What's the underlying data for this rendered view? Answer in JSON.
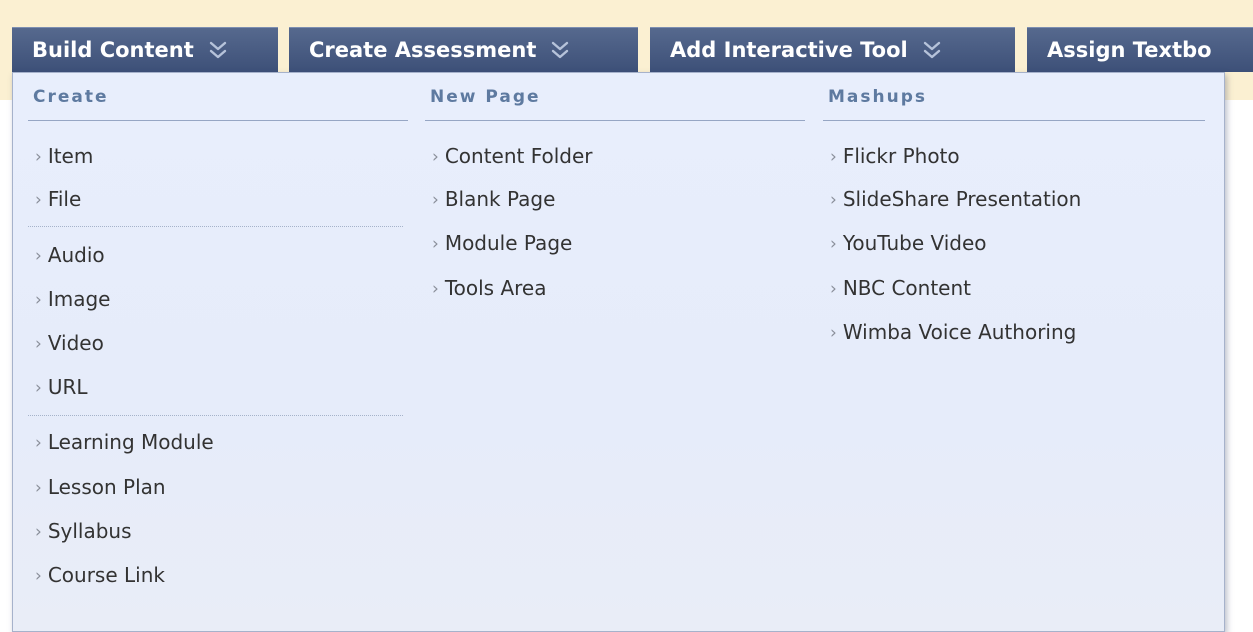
{
  "tabs": [
    {
      "label": "Build Content"
    },
    {
      "label": "Create Assessment"
    },
    {
      "label": "Add Interactive Tool"
    },
    {
      "label": "Assign Textbo"
    }
  ],
  "icons": {
    "tab_chevron": "double-chevron-down-icon",
    "item_arrow": "chevron-right-icon"
  },
  "dropdown": {
    "create": {
      "header": "Create",
      "items": [
        {
          "label": "Item"
        },
        {
          "label": "File"
        },
        {
          "label": "Audio"
        },
        {
          "label": "Image"
        },
        {
          "label": "Video"
        },
        {
          "label": "URL"
        },
        {
          "label": "Learning Module"
        },
        {
          "label": "Lesson Plan"
        },
        {
          "label": "Syllabus"
        },
        {
          "label": "Course Link"
        }
      ]
    },
    "new_page": {
      "header": "New Page",
      "items": [
        {
          "label": "Content Folder"
        },
        {
          "label": "Blank Page"
        },
        {
          "label": "Module Page"
        },
        {
          "label": "Tools Area"
        }
      ]
    },
    "mashups": {
      "header": "Mashups",
      "items": [
        {
          "label": "Flickr Photo"
        },
        {
          "label": "SlideShare Presentation"
        },
        {
          "label": "YouTube Video"
        },
        {
          "label": "NBC Content"
        },
        {
          "label": "Wimba Voice Authoring"
        }
      ]
    }
  },
  "colors": {
    "tab_bg": "#4a5d84",
    "top_strip": "#fbf0d2",
    "dropdown_bg": "#e6ecfa",
    "header_text": "#5e7aa0",
    "item_text": "#333333"
  }
}
